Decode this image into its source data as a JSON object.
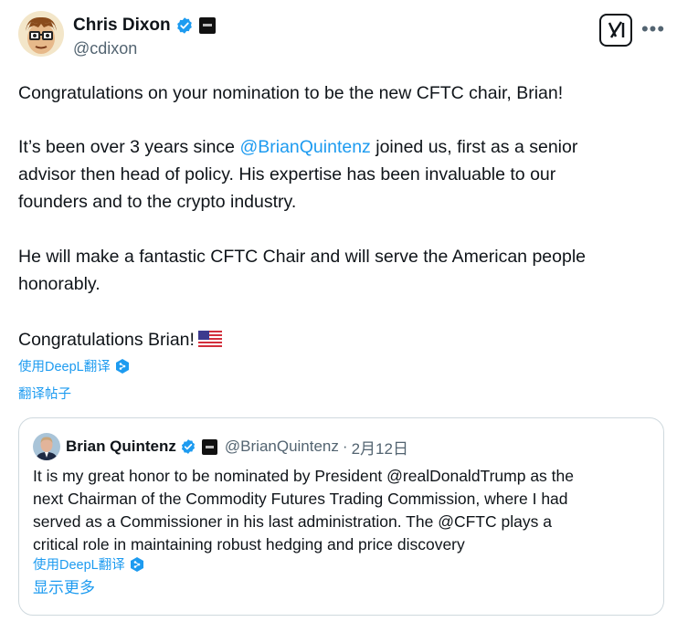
{
  "author": {
    "name": "Chris Dixon",
    "handle": "@cdixon"
  },
  "tweet": {
    "p1": "Congratulations on your nomination to be the new CFTC chair, Brian!",
    "p2_line1_before": "It’s been over 3 years since ",
    "p2_mention": "@BrianQuintenz",
    "p2_line1_after": " joined us, first as a senior",
    "p2_line2": "advisor then head of policy. His expertise has been invaluable to our",
    "p2_line3": "founders and to the crypto industry.",
    "p3_line1": "He will make a fantastic CFTC Chair and will serve the American people",
    "p3_line2": "honorably.",
    "p4": "Congratulations Brian!",
    "flag_icon": "us-flag-emoji",
    "translate_deepl": "使用DeepL翻译",
    "translate_post": "翻译帖子"
  },
  "quote": {
    "name": "Brian Quintenz",
    "handle": "@BrianQuintenz",
    "separator": "·",
    "date": "2月12日",
    "lines": [
      "It is my great honor to be nominated by President @realDonaldTrump as the",
      "next Chairman of the Commodity Futures Trading Commission, where I had",
      "served as a Commissioner in his last administration. The @CFTC plays a",
      "critical role in maintaining robust hedging and price discovery"
    ],
    "translate_deepl": "使用DeepL翻译",
    "show_more": "显示更多"
  },
  "colors": {
    "accent": "#1d9bf0",
    "text": "#0f1419",
    "muted": "#536471",
    "border": "#cfd9de"
  }
}
